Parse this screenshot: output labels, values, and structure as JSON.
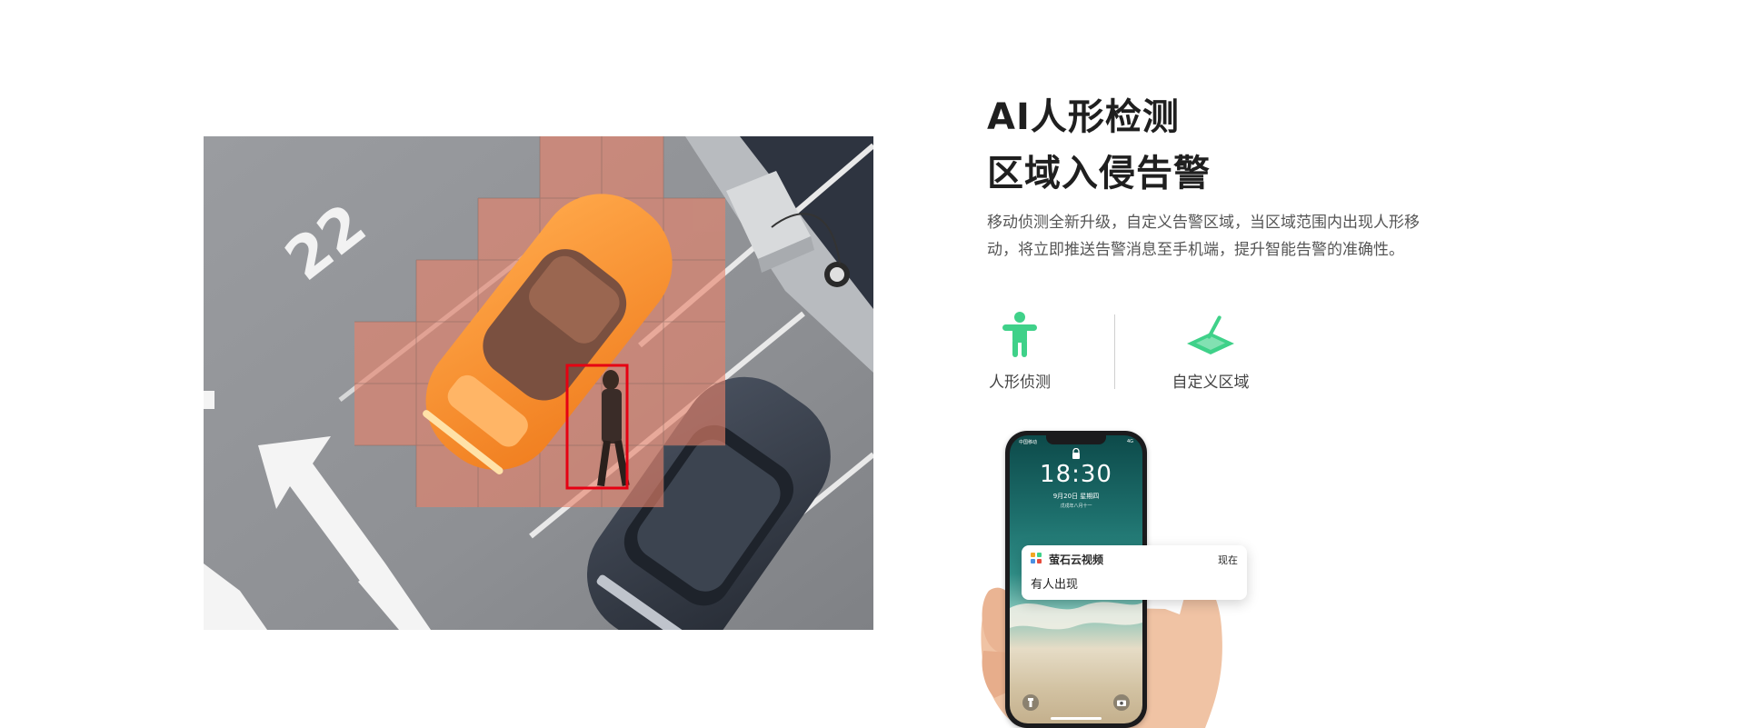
{
  "heading": {
    "line1": "AI人形检测",
    "line2": "区域入侵告警"
  },
  "description": "移动侦测全新升级，自定义告警区域，当区域范围内出现人形移动，将立即推送告警消息至手机端，提升智能告警的准确性。",
  "features": [
    {
      "label": "人形侦测",
      "icon": "human-figure-icon"
    },
    {
      "label": "自定义区域",
      "icon": "custom-zone-icon"
    }
  ],
  "scene": {
    "parking_number": "22"
  },
  "phone": {
    "carrier": "中国移动",
    "status": "4G",
    "time": "18:30",
    "date": "9月20日 星期四",
    "lunar": "戊戌年八月十一"
  },
  "notification": {
    "app": "萤石云视频",
    "time": "现在",
    "body": "有人出现"
  },
  "colors": {
    "accent": "#3fd189",
    "heading": "#1f1f1f",
    "detection_box": "#e60012",
    "zone_overlay": "#e8826a"
  }
}
